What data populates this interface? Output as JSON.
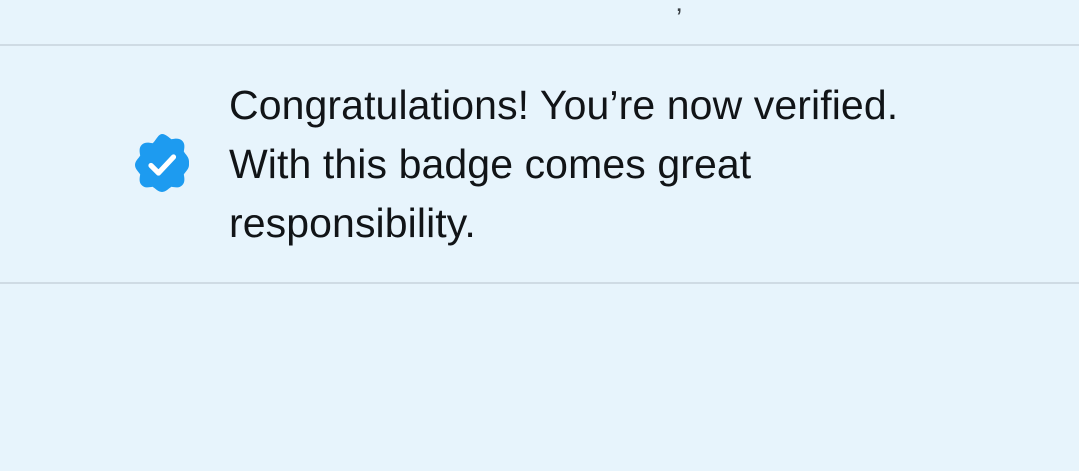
{
  "notification": {
    "icon": "verified-badge-icon",
    "message_lines": [
      "Congratulations! You’re now verified.",
      "With this badge comes great",
      "responsibility."
    ]
  },
  "colors": {
    "background": "#e7f4fc",
    "badge_blue": "#1d9bf0",
    "divider": "#cfdbe4",
    "text": "#111417"
  }
}
